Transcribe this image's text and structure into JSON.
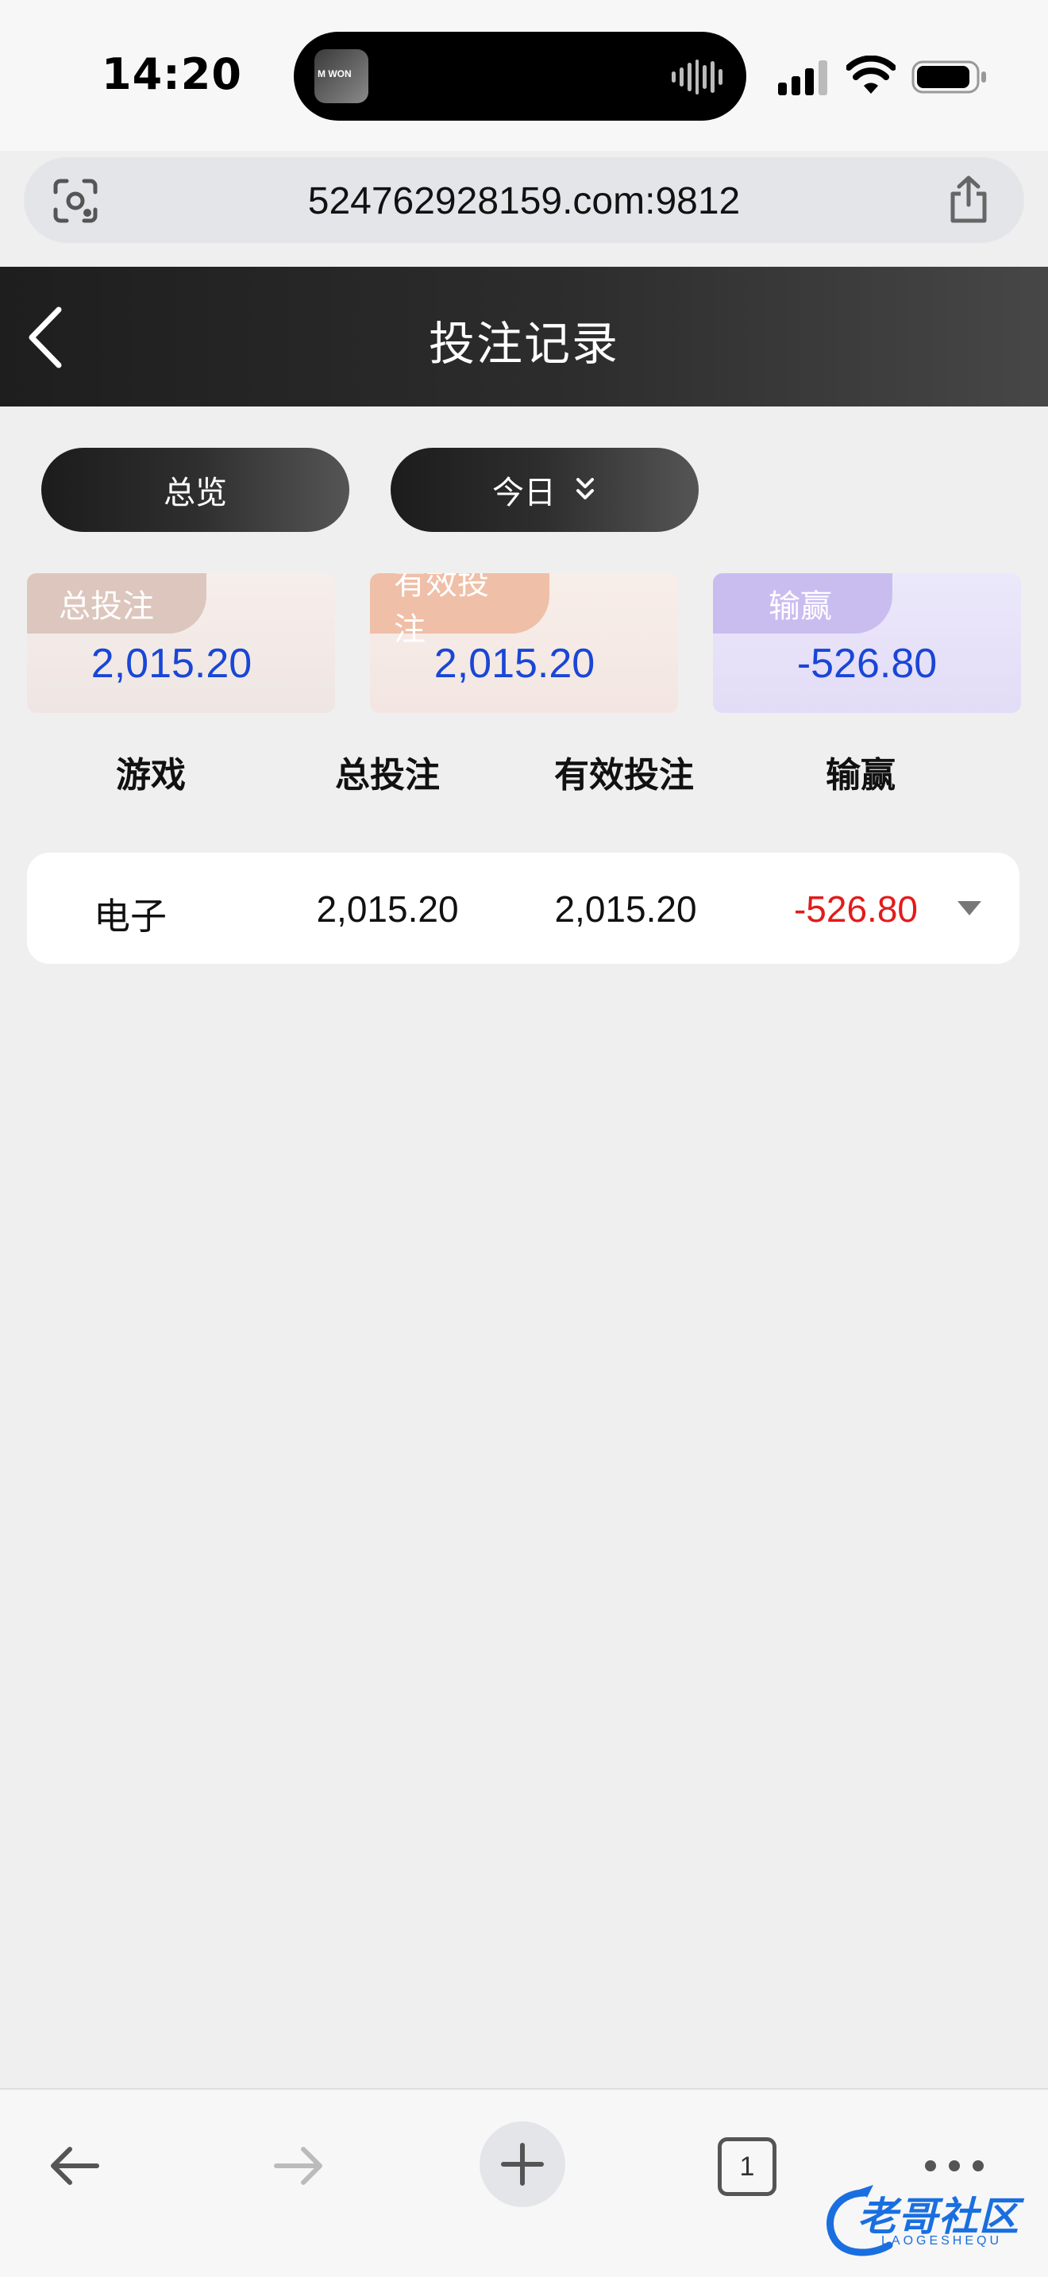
{
  "status_bar": {
    "time": "14:20",
    "island_art_text": "M WON"
  },
  "browser": {
    "url": "524762928159.com:9812",
    "tab_count": "1"
  },
  "header": {
    "title": "投注记录"
  },
  "filters": {
    "overview_label": "总览",
    "period_label": "今日"
  },
  "summary": {
    "total_bet": {
      "label": "总投注",
      "value": "2,015.20"
    },
    "valid_bet": {
      "label": "有效投注",
      "value": "2,015.20"
    },
    "win_loss": {
      "label": "输赢",
      "value": "-526.80"
    }
  },
  "table": {
    "columns": [
      "游戏",
      "总投注",
      "有效投注",
      "输赢"
    ],
    "rows": [
      {
        "game": "电子",
        "total": "2,015.20",
        "valid": "2,015.20",
        "win_loss": "-526.80"
      }
    ]
  },
  "watermark": {
    "text": "老哥社区",
    "sub": "LAOGESHEQU"
  },
  "colors": {
    "value_blue": "#1946d6",
    "loss_red": "#e21b1b",
    "header_dark": "#1e1e1e"
  }
}
